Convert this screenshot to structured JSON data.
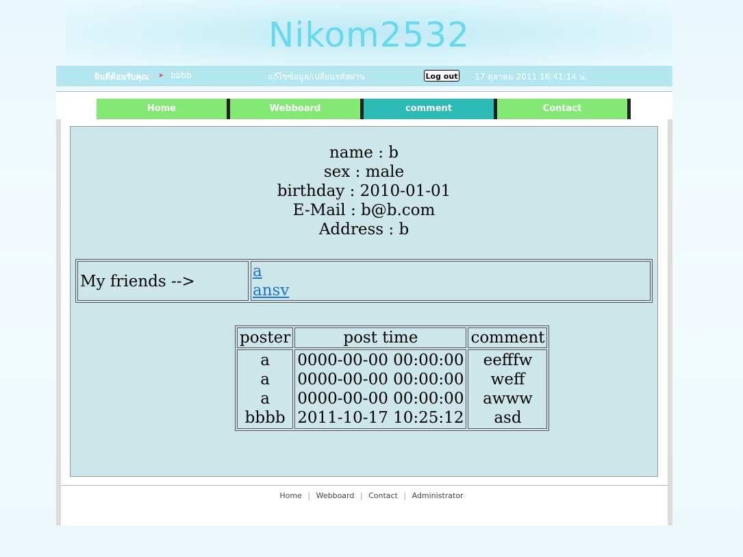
{
  "site": {
    "title": "Nikom2532"
  },
  "topbar": {
    "welcome": "ยินดีต้อนรับคุณ",
    "arrow": "➤",
    "username": "bbbb",
    "edit_profile": "แก้ไขข้อมูล/เปลี่ยนรหัสผ่าน",
    "logout": "Log out",
    "datetime": "17 ตุลาคม 2011 16:41:14 น."
  },
  "nav": [
    {
      "label": "Home",
      "active": false
    },
    {
      "label": "Webboard",
      "active": false
    },
    {
      "label": "comment",
      "active": true
    },
    {
      "label": "Contact",
      "active": false
    }
  ],
  "profile": {
    "name": "name : b",
    "sex": "sex : male",
    "birthday": "birthday : 2010-01-01",
    "email": "E-Mail : b@b.com",
    "address": "Address : b"
  },
  "friends": {
    "label": "My friends -->",
    "list": [
      "a",
      "ansv"
    ]
  },
  "posts": {
    "headers": [
      "poster",
      "post time",
      "comment"
    ],
    "rows": [
      {
        "poster": "a",
        "time": "0000-00-00 00:00:00",
        "comment": "eefffw"
      },
      {
        "poster": "a",
        "time": "0000-00-00 00:00:00",
        "comment": "weff"
      },
      {
        "poster": "a",
        "time": "0000-00-00 00:00:00",
        "comment": "awww"
      },
      {
        "poster": "bbbb",
        "time": "2011-10-17 10:25:12",
        "comment": "asd"
      }
    ]
  },
  "footer": {
    "links": [
      "Home",
      "Webboard",
      "Contact",
      "Administrator"
    ],
    "separator": "|"
  },
  "colors": {
    "title": "#66d9ee",
    "topbar": "#b3e6ef",
    "nav": "#83e874",
    "nav_active": "#2bbbb4",
    "content_bg": "#cce6ea",
    "link": "#1a73d9"
  }
}
